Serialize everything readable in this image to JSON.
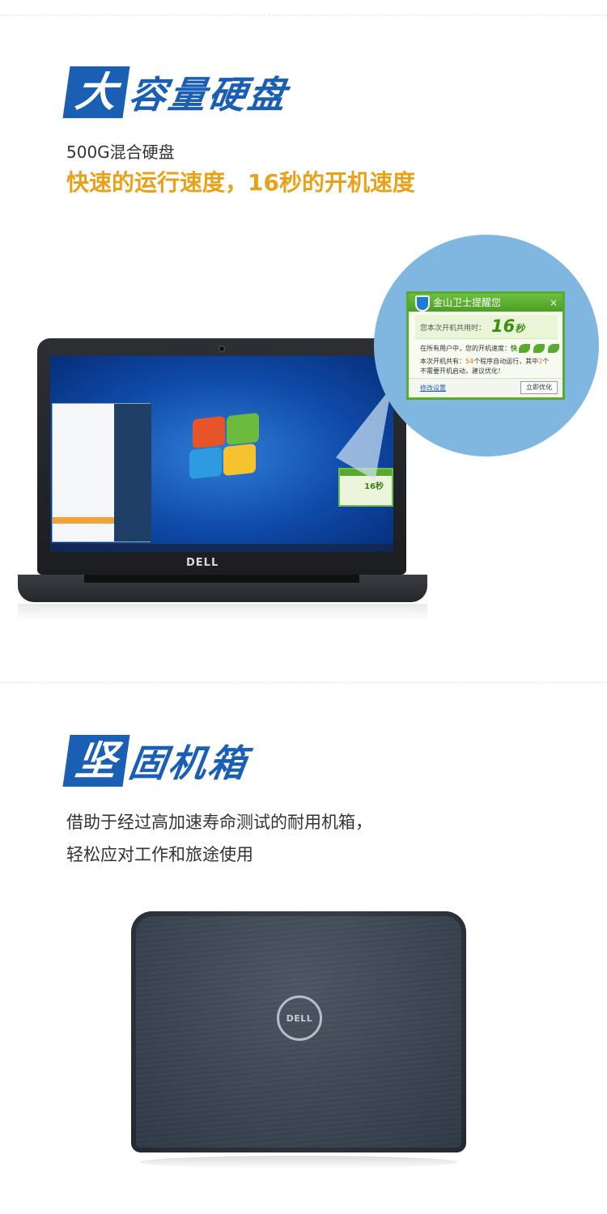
{
  "section1": {
    "heading_first": "大",
    "heading_rest": "容量硬盘",
    "subtitle": "500G混合硬盘",
    "highlight": "快速的运行速度，16秒的开机速度"
  },
  "laptop1": {
    "brand": "DELL"
  },
  "popup": {
    "title": "金山卫士提醒您",
    "close": "×",
    "time_label": "您本次开机共用时：",
    "time_value": "16",
    "time_unit": "秒",
    "speed_prefix": "在所有用户中，您的开机速度：",
    "speed_value": "快",
    "line2_pre": "本次开机共有：",
    "line2_count": "54",
    "line2_mid": "个程序自动运行，其中",
    "line2_count2": "2",
    "line2_post": "个",
    "line3": "不需要开机启动，建议优化！",
    "link": "修改设置",
    "button": "立即优化"
  },
  "mini_popup": {
    "value": "16秒"
  },
  "section2": {
    "heading_first": "坚",
    "heading_rest": "固机箱",
    "line1": "借助于经过高加速寿命测试的耐用机箱，",
    "line2": "轻松应对工作和旅途使用"
  },
  "laptop2": {
    "brand": "DELL"
  },
  "colors": {
    "heading_blue": "#1a5fb4",
    "highlight_orange": "#e8a21a",
    "popup_green": "#5aaa2f"
  }
}
